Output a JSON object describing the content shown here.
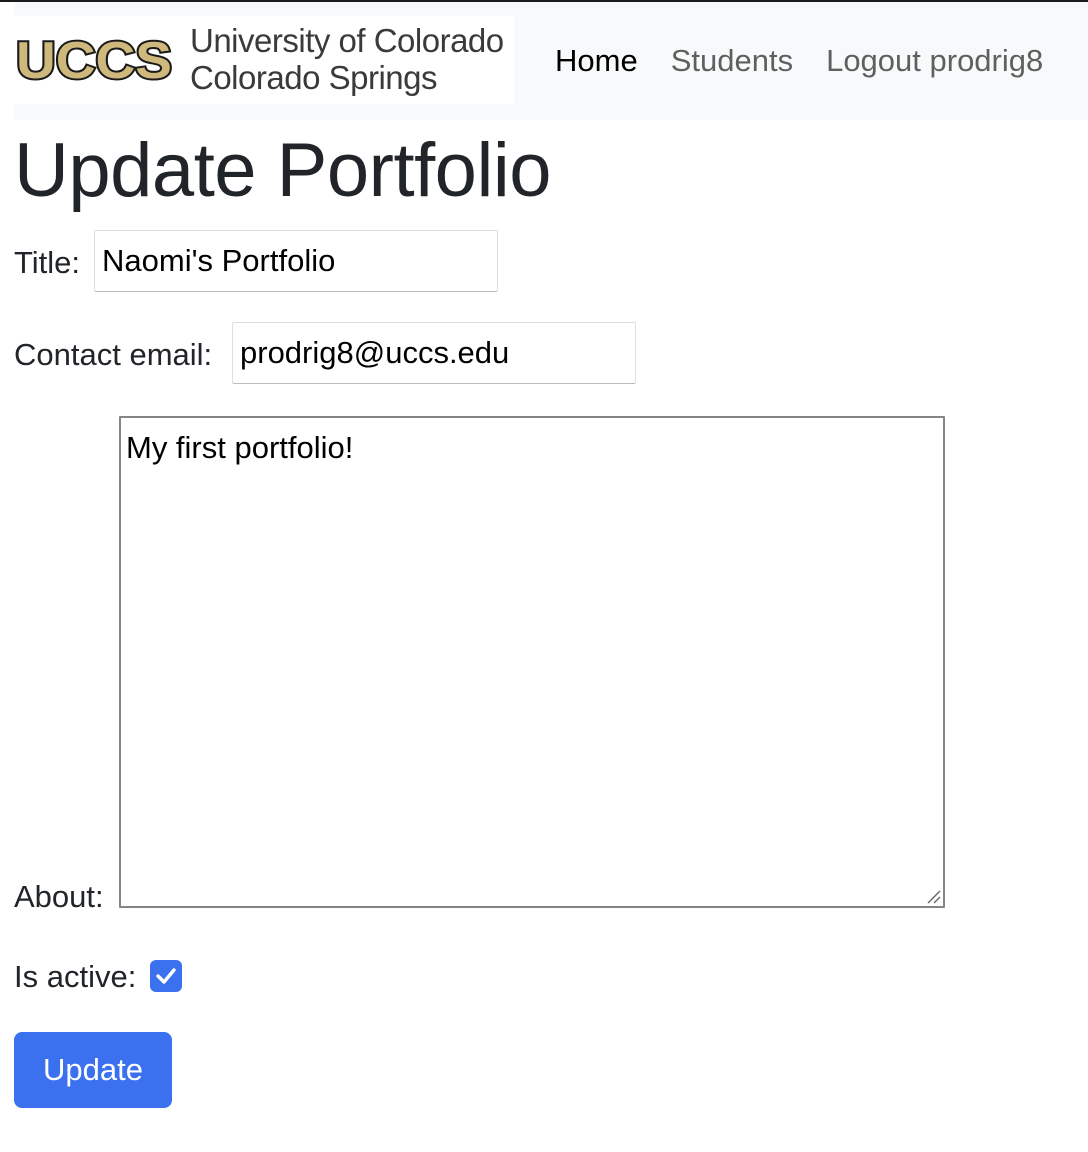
{
  "header": {
    "logo_wordmark": "UCCS",
    "logo_line1": "University of Colorado",
    "logo_line2": "Colorado Springs",
    "nav": [
      {
        "label": "Home",
        "active": true
      },
      {
        "label": "Students",
        "active": false
      },
      {
        "label": "Logout prodrig8",
        "active": false
      }
    ]
  },
  "page": {
    "title": "Update Portfolio"
  },
  "form": {
    "title_label": "Title:",
    "title_value": "Naomi's Portfolio",
    "email_label": "Contact email:",
    "email_value": "prodrig8@uccs.edu",
    "about_label": "About:",
    "about_value": "My first portfolio!",
    "active_label": "Is active:",
    "active_checked": true,
    "submit_label": "Update"
  },
  "colors": {
    "primary": "#3b71ef",
    "logo_gold": "#cfb87c",
    "navbar_bg": "#f8f9fa"
  },
  "icons": {
    "checkbox": "checkmark-icon",
    "textarea_grip": "resize-grip-icon"
  }
}
